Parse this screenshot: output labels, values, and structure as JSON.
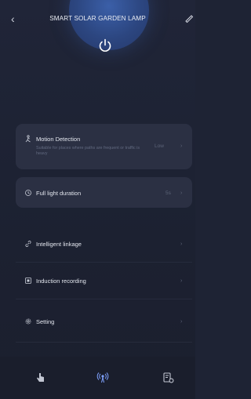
{
  "header": {
    "title": "SMART SOLAR GARDEN LAMP"
  },
  "motion": {
    "label": "Motion Detection",
    "description": "Suitable for places where paths are frequent or traffic is heavy",
    "value": "Low"
  },
  "full_light": {
    "label": "Full light duration",
    "value": "5s"
  },
  "menu": {
    "intelligent": "Intelligent linkage",
    "induction": "Induction recording",
    "setting": "Setting"
  },
  "icons": [
    "back-arrow",
    "edit-pencil",
    "power",
    "motion-sensor",
    "light-clock",
    "link",
    "record",
    "gear",
    "hand-touch",
    "signal-antenna",
    "device-settings"
  ],
  "colors": {
    "background": "#1e2334",
    "card": "#2b3043",
    "accent": "#3b5fa8"
  }
}
